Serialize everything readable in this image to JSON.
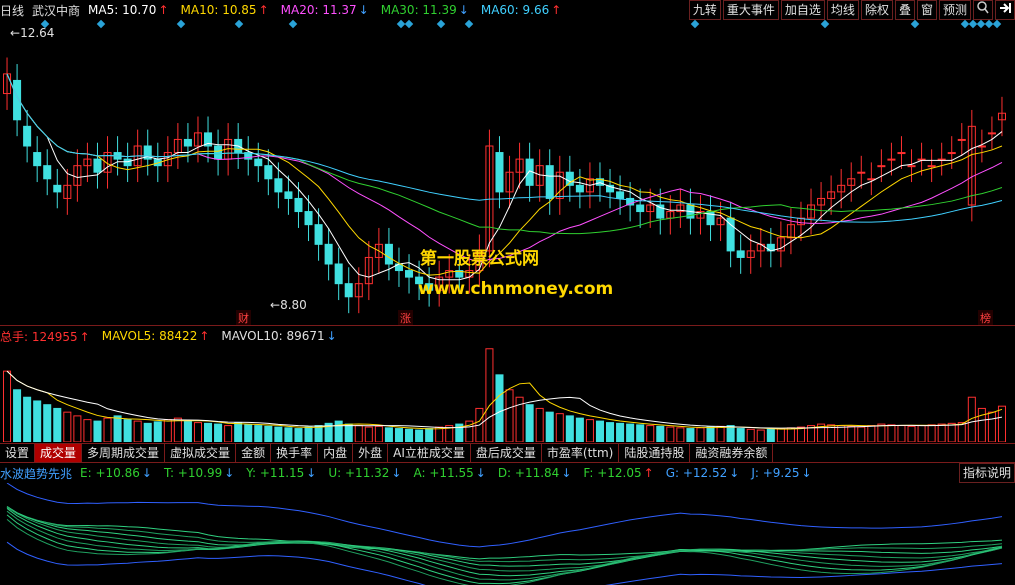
{
  "header": {
    "items": [
      {
        "text": "日线",
        "color": "#e0e0e0",
        "name": "period-label"
      },
      {
        "text": "武汉中商",
        "color": "#e0e0e0",
        "name": "stock-name"
      },
      {
        "text": "MA5: 10.70",
        "color": "#ffffff",
        "arrow": "↑",
        "arrowColor": "#ff3030",
        "name": "ma5-readout"
      },
      {
        "text": "MA10: 10.85",
        "color": "#ffd800",
        "arrow": "↑",
        "arrowColor": "#ff3030",
        "name": "ma10-readout"
      },
      {
        "text": "MA20: 11.37",
        "color": "#ff50ff",
        "arrow": "↓",
        "arrowColor": "#40a0ff",
        "name": "ma20-readout"
      },
      {
        "text": "MA30: 11.39",
        "color": "#30d030",
        "arrow": "↓",
        "arrowColor": "#40a0ff",
        "name": "ma30-readout"
      },
      {
        "text": "MA60: 9.66",
        "color": "#40d0ff",
        "arrow": "↑",
        "arrowColor": "#ff3030",
        "name": "ma60-readout"
      }
    ],
    "buttons": [
      "九转",
      "重大事件",
      "加自选",
      "均线",
      "除权",
      "叠",
      "窗",
      "预测"
    ]
  },
  "main_chart": {
    "high_label": "12.64",
    "low_label": "8.80",
    "markers": [
      "财",
      "涨",
      "榜"
    ],
    "watermark": {
      "title": "第一股票公式网",
      "url": "www.chnmoney.com"
    }
  },
  "volume_header": {
    "items": [
      {
        "text": "总手: 124955",
        "color": "#ff3030",
        "arrow": "↑",
        "arrowColor": "#ff3030",
        "name": "total-volume-readout"
      },
      {
        "text": "MAVOL5: 88422",
        "color": "#ffd800",
        "arrow": "↑",
        "arrowColor": "#ff3030",
        "name": "mavol5-readout"
      },
      {
        "text": "MAVOL10: 89671",
        "color": "#e0e0e0",
        "arrow": "↓",
        "arrowColor": "#40a0ff",
        "name": "mavol10-readout"
      }
    ]
  },
  "tabs": [
    {
      "label": "设置",
      "active": false
    },
    {
      "label": "成交量",
      "active": true
    },
    {
      "label": "多周期成交量",
      "active": false
    },
    {
      "label": "虚拟成交量",
      "active": false
    },
    {
      "label": "金额",
      "active": false
    },
    {
      "label": "换手率",
      "active": false
    },
    {
      "label": "内盘",
      "active": false
    },
    {
      "label": "外盘",
      "active": false
    },
    {
      "label": "AI立桩成交量",
      "active": false
    },
    {
      "label": "盘后成交量",
      "active": false
    },
    {
      "label": "市盈率(ttm)",
      "active": false
    },
    {
      "label": "陆股通持股",
      "active": false
    },
    {
      "label": "融资融券余额",
      "active": false
    }
  ],
  "indicator_header": {
    "items": [
      {
        "text": "水波趋势先兆",
        "color": "#40a0ff",
        "arrow": "",
        "name": "indicator-name"
      },
      {
        "text": "E: +10.86",
        "color": "#30d030",
        "arrow": "↓",
        "arrowColor": "#40a0ff",
        "name": "e-readout"
      },
      {
        "text": "T: +10.99",
        "color": "#30d030",
        "arrow": "↓",
        "arrowColor": "#40a0ff",
        "name": "t-readout"
      },
      {
        "text": "Y: +11.15",
        "color": "#30d030",
        "arrow": "↓",
        "arrowColor": "#40a0ff",
        "name": "y-readout"
      },
      {
        "text": "U: +11.32",
        "color": "#30d030",
        "arrow": "↓",
        "arrowColor": "#40a0ff",
        "name": "u-readout"
      },
      {
        "text": "A: +11.55",
        "color": "#30d030",
        "arrow": "↓",
        "arrowColor": "#40a0ff",
        "name": "a-readout"
      },
      {
        "text": "D: +11.84",
        "color": "#30d030",
        "arrow": "↓",
        "arrowColor": "#40a0ff",
        "name": "d-readout"
      },
      {
        "text": "F: +12.05",
        "color": "#30d030",
        "arrow": "↑",
        "arrowColor": "#ff3030",
        "name": "f-readout"
      },
      {
        "text": "G: +12.52",
        "color": "#40a0ff",
        "arrow": "↓",
        "arrowColor": "#40a0ff",
        "name": "g-readout"
      },
      {
        "text": "J: +9.25",
        "color": "#40a0ff",
        "arrow": "↓",
        "arrowColor": "#40a0ff",
        "name": "j-readout"
      }
    ],
    "help_button": "指标说明"
  },
  "chart_data": {
    "type": "candlestick",
    "ylim": [
      8.5,
      13.0
    ],
    "closes": [
      12.3,
      11.6,
      11.2,
      10.9,
      10.7,
      10.5,
      10.6,
      10.9,
      11.0,
      10.8,
      11.1,
      11.0,
      10.9,
      11.2,
      11.0,
      10.9,
      11.1,
      11.3,
      11.2,
      11.4,
      11.2,
      11.0,
      11.3,
      11.1,
      11.0,
      10.9,
      10.7,
      10.5,
      10.4,
      10.2,
      10.0,
      9.7,
      9.4,
      9.1,
      8.9,
      9.1,
      9.5,
      9.7,
      9.4,
      9.3,
      9.2,
      9.1,
      9.0,
      9.2,
      9.3,
      9.2,
      9.3,
      9.6,
      11.2,
      10.5,
      10.8,
      11.0,
      10.6,
      10.9,
      10.4,
      10.8,
      10.6,
      10.5,
      10.7,
      10.6,
      10.5,
      10.4,
      10.3,
      10.2,
      10.3,
      10.1,
      10.2,
      10.3,
      10.1,
      10.2,
      10.0,
      10.1,
      9.6,
      9.5,
      9.6,
      9.7,
      9.6,
      9.8,
      10.0,
      10.1,
      10.3,
      10.4,
      10.5,
      10.6,
      10.7,
      10.8,
      10.7,
      10.9,
      11.0,
      11.1,
      10.9,
      11.0,
      10.9,
      11.0,
      11.1,
      11.3,
      11.5,
      11.2,
      11.4,
      11.7
    ],
    "opens": [
      12.0,
      12.2,
      11.5,
      11.1,
      10.9,
      10.6,
      10.4,
      10.6,
      10.9,
      11.0,
      10.8,
      11.1,
      11.0,
      10.9,
      11.2,
      11.0,
      10.9,
      11.1,
      11.3,
      11.2,
      11.4,
      11.2,
      11.0,
      11.3,
      11.1,
      11.0,
      10.9,
      10.7,
      10.5,
      10.4,
      10.2,
      10.0,
      9.7,
      9.4,
      9.1,
      8.9,
      9.1,
      9.5,
      9.7,
      9.4,
      9.3,
      9.2,
      9.1,
      9.0,
      9.2,
      9.3,
      9.2,
      9.3,
      9.6,
      11.1,
      10.5,
      10.8,
      11.0,
      10.6,
      10.9,
      10.4,
      10.8,
      10.6,
      10.5,
      10.7,
      10.6,
      10.5,
      10.4,
      10.3,
      10.2,
      10.3,
      10.1,
      10.2,
      10.3,
      10.1,
      10.2,
      10.0,
      10.1,
      9.6,
      9.5,
      9.6,
      9.7,
      9.6,
      9.8,
      10.0,
      10.1,
      10.3,
      10.4,
      10.5,
      10.6,
      10.8,
      10.7,
      10.9,
      11.0,
      11.1,
      10.9,
      11.0,
      10.9,
      11.0,
      11.1,
      11.3,
      10.3,
      11.2,
      11.4,
      11.6
    ],
    "volume_ylim": [
      0,
      130000
    ],
    "volumes": [
      95000,
      70000,
      60000,
      55000,
      50000,
      45000,
      40000,
      35000,
      30000,
      28000,
      32000,
      35000,
      30000,
      28000,
      25000,
      27000,
      30000,
      32000,
      28000,
      26000,
      25000,
      24000,
      22000,
      26000,
      23000,
      22000,
      21000,
      20000,
      19000,
      18000,
      20000,
      22000,
      25000,
      28000,
      24000,
      22000,
      20000,
      21000,
      19000,
      18000,
      17000,
      16000,
      18000,
      20000,
      22000,
      24000,
      28000,
      45000,
      124955,
      90000,
      70000,
      60000,
      50000,
      45000,
      40000,
      38000,
      35000,
      32000,
      30000,
      28000,
      26000,
      25000,
      24000,
      23000,
      22000,
      21000,
      20000,
      19000,
      18000,
      19000,
      20000,
      21000,
      22000,
      18000,
      17000,
      16000,
      17000,
      18000,
      19000,
      20000,
      22000,
      24000,
      23000,
      22000,
      21000,
      20000,
      22000,
      24000,
      23000,
      22000,
      21000,
      22000,
      23000,
      24000,
      25000,
      26000,
      60000,
      45000,
      40000,
      48000
    ]
  }
}
